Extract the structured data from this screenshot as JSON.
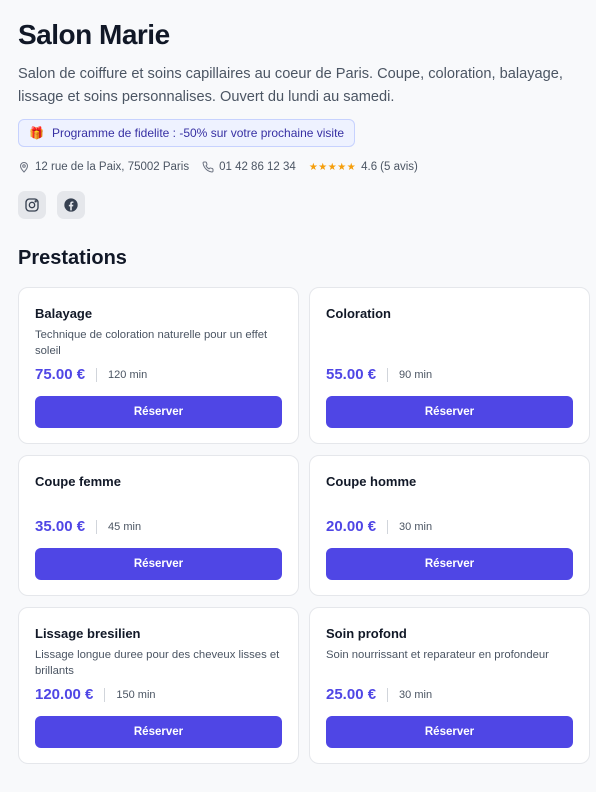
{
  "salon": {
    "name": "Salon Marie",
    "description": "Salon de coiffure et soins capillaires au coeur de Paris. Coupe, coloration, balayage, lissage et soins personnalises. Ouvert du lundi au samedi.",
    "promo": {
      "icon": "gift-icon",
      "text": "Programme de fidelite : -50% sur votre prochaine visite"
    },
    "address": "12 rue de la Paix, 75002 Paris",
    "phone": "01 42 86 12 34",
    "rating": {
      "stars": "★★★★★",
      "value": "4.6",
      "count_text": "(5 avis)"
    },
    "socials": [
      {
        "icon": "instagram-icon"
      },
      {
        "icon": "facebook-icon"
      }
    ]
  },
  "section_title": "Prestations",
  "services": [
    {
      "name": "Balayage",
      "description": "Technique de coloration naturelle pour un effet soleil",
      "price": "75.00 €",
      "duration": "120 min",
      "button": "Réserver"
    },
    {
      "name": "Coloration",
      "description": "",
      "price": "55.00 €",
      "duration": "90 min",
      "button": "Réserver"
    },
    {
      "name": "Coupe femme",
      "description": "",
      "price": "35.00 €",
      "duration": "45 min",
      "button": "Réserver"
    },
    {
      "name": "Coupe homme",
      "description": "",
      "price": "20.00 €",
      "duration": "30 min",
      "button": "Réserver"
    },
    {
      "name": "Lissage bresilien",
      "description": "Lissage longue duree pour des cheveux lisses et brillants",
      "price": "120.00 €",
      "duration": "150 min",
      "button": "Réserver"
    },
    {
      "name": "Soin profond",
      "description": "Soin nourrissant et reparateur en profondeur",
      "price": "25.00 €",
      "duration": "30 min",
      "button": "Réserver"
    }
  ],
  "colors": {
    "accent": "#4f46e5",
    "star": "#f59e0b"
  }
}
